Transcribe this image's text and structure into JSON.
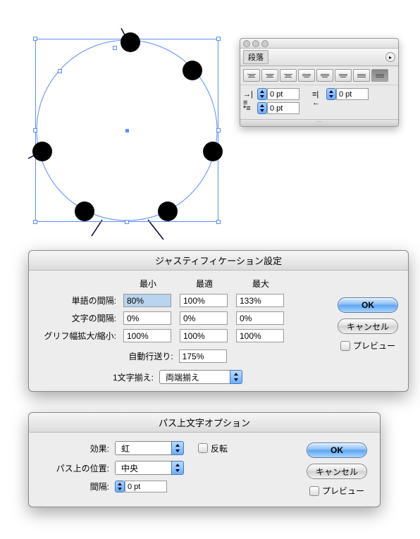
{
  "panel": {
    "title": "段落",
    "indent_left": "0 pt",
    "indent_right": "0 pt",
    "indent_first": "0 pt"
  },
  "dialog1": {
    "title": "ジャスティフィケーション設定",
    "col_min": "最小",
    "col_des": "最適",
    "col_max": "最大",
    "row_word": "単語の間隔:",
    "row_letter": "文字の間隔:",
    "row_glyph": "グリフ幅拡大/縮小:",
    "word_min": "80%",
    "word_des": "100%",
    "word_max": "133%",
    "letter_min": "0%",
    "letter_des": "0%",
    "letter_max": "0%",
    "glyph_min": "100%",
    "glyph_des": "100%",
    "glyph_max": "100%",
    "autoleading_label": "自動行送り:",
    "autoleading": "175%",
    "single_label": "1文字揃え:",
    "single_value": "両端揃え",
    "ok": "OK",
    "cancel": "キャンセル",
    "preview": "プレビュー"
  },
  "dialog2": {
    "title": "パス上文字オプション",
    "effect_label": "効果:",
    "effect_value": "虹",
    "flip": "反転",
    "align_label": "パス上の位置:",
    "align_value": "中央",
    "spacing_label": "間隔:",
    "spacing_value": "0 pt",
    "ok": "OK",
    "cancel": "キャンセル",
    "preview": "プレビュー"
  }
}
